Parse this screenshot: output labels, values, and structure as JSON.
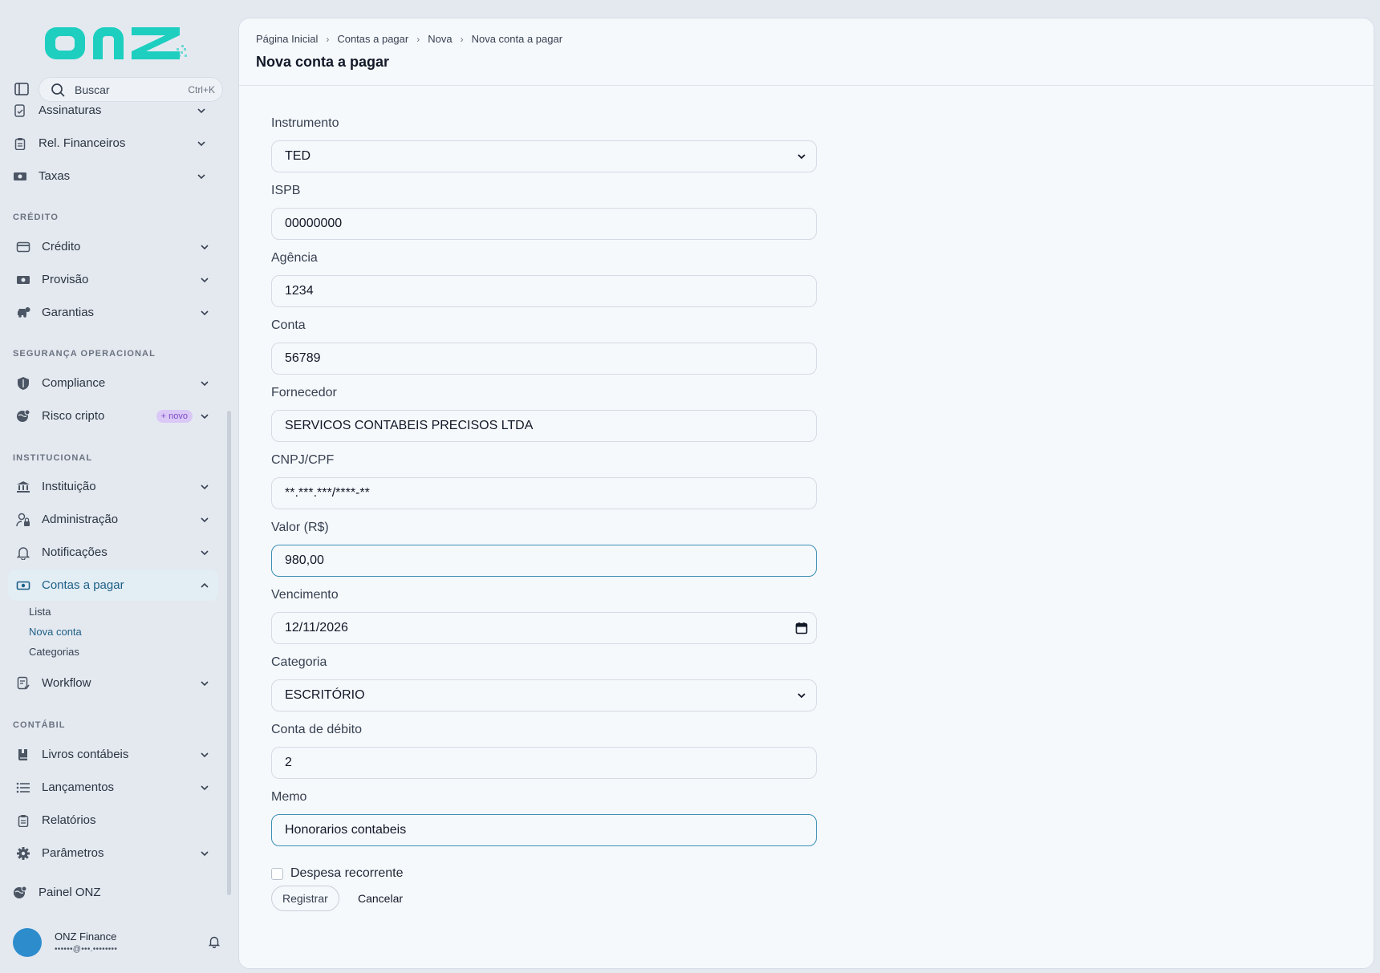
{
  "brand": {
    "logo_text": "onz",
    "accent": "#1ecfc0"
  },
  "search": {
    "placeholder": "Buscar",
    "shortcut": "Ctrl+K"
  },
  "sidebar": {
    "items": [
      {
        "label": "Assinaturas",
        "icon": "doc-check-icon"
      },
      {
        "label": "Rel. Financeiros",
        "icon": "clipboard-icon"
      },
      {
        "label": "Taxas",
        "icon": "money-icon"
      }
    ],
    "sections": [
      {
        "title": "CRÉDITO",
        "items": [
          {
            "label": "Crédito",
            "icon": "card-icon"
          },
          {
            "label": "Provisão",
            "icon": "money-icon"
          },
          {
            "label": "Garantias",
            "icon": "car-icon"
          }
        ]
      },
      {
        "title": "SEGURANÇA OPERACIONAL",
        "items": [
          {
            "label": "Compliance",
            "icon": "shield-icon"
          },
          {
            "label": "Risco cripto",
            "icon": "globe-icon",
            "badge": "+ novo"
          }
        ]
      },
      {
        "title": "INSTITUCIONAL",
        "items": [
          {
            "label": "Instituição",
            "icon": "bank-icon"
          },
          {
            "label": "Administração",
            "icon": "user-lock-icon"
          },
          {
            "label": "Notificações",
            "icon": "bell-icon"
          },
          {
            "label": "Contas a pagar",
            "icon": "money-icon",
            "active": true,
            "subitems": [
              "Lista",
              "Nova conta",
              "Categorias"
            ]
          },
          {
            "label": "Workflow",
            "icon": "workflow-icon"
          }
        ]
      },
      {
        "title": "CONTÁBIL",
        "items": [
          {
            "label": "Livros contábeis",
            "icon": "book-icon"
          },
          {
            "label": "Lançamentos",
            "icon": "list-icon"
          },
          {
            "label": "Relatórios",
            "icon": "clipboard-icon"
          },
          {
            "label": "Parâmetros",
            "icon": "gear-icon"
          }
        ]
      }
    ],
    "footer_link": "Painel ONZ"
  },
  "user": {
    "name": "ONZ Finance",
    "email": "••••••@•••.••••••••"
  },
  "breadcrumb": [
    "Página Inicial",
    "Contas a pagar",
    "Nova",
    "Nova conta a pagar"
  ],
  "page_title": "Nova conta a pagar",
  "form": {
    "instrumento": {
      "label": "Instrumento",
      "value": "TED"
    },
    "ispb": {
      "label": "ISPB",
      "value": "00000000"
    },
    "agencia": {
      "label": "Agência",
      "value": "1234"
    },
    "conta": {
      "label": "Conta",
      "value": "56789"
    },
    "fornecedor": {
      "label": "Fornecedor",
      "value": "SERVICOS CONTABEIS PRECISOS LTDA"
    },
    "cnpj": {
      "label": "CNPJ/CPF",
      "value": "**.***.***/****-**"
    },
    "valor": {
      "label": "Valor (R$)",
      "value": "980,00"
    },
    "vencimento": {
      "label": "Vencimento",
      "value": "12/11/2026"
    },
    "categoria": {
      "label": "Categoria",
      "value": "ESCRITÓRIO"
    },
    "conta_debito": {
      "label": "Conta de débito",
      "value": "2"
    },
    "memo": {
      "label": "Memo",
      "value": "Honorarios contabeis"
    },
    "recorrente": {
      "label": "Despesa recorrente",
      "checked": false
    },
    "submit_label": "Registrar",
    "cancel_label": "Cancelar"
  }
}
